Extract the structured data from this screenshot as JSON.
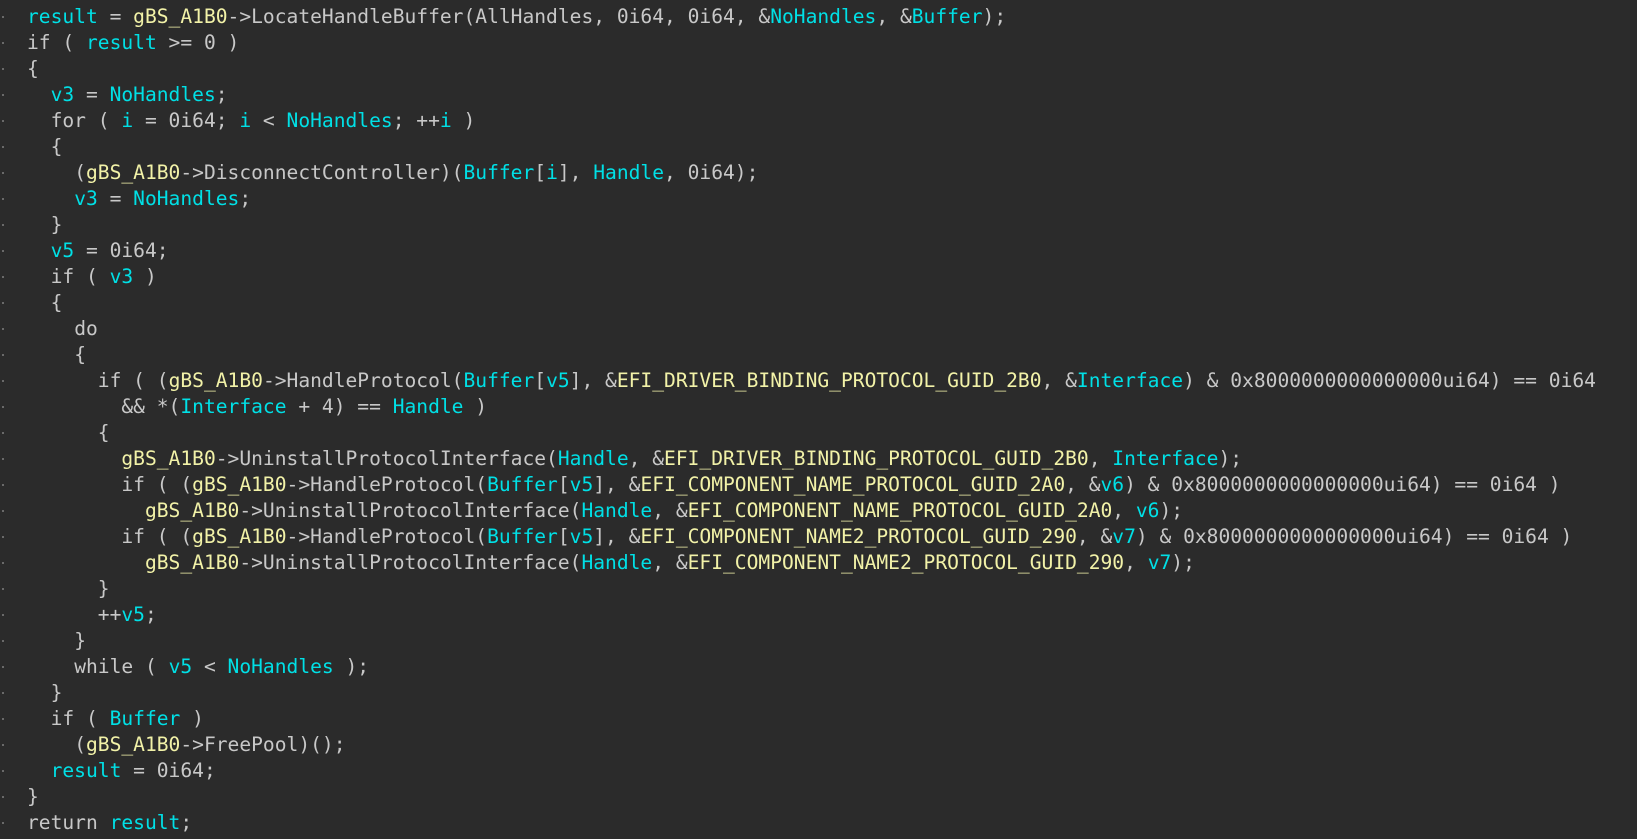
{
  "colors": {
    "background": "#2b2b2b",
    "default_text": "#c8c8c8",
    "variable": "#00e0e6",
    "global": "#f2f2a8"
  },
  "code_lines": [
    {
      "indent": 0,
      "tokens": [
        [
          "result",
          "variable"
        ],
        [
          " = ",
          "default"
        ],
        [
          "gBS_A1B0",
          "global"
        ],
        [
          "->LocateHandleBuffer(AllHandles, 0i64, 0i64, &",
          "default"
        ],
        [
          "NoHandles",
          "variable"
        ],
        [
          ", &",
          "default"
        ],
        [
          "Buffer",
          "variable"
        ],
        [
          ");",
          "default"
        ]
      ]
    },
    {
      "indent": 0,
      "tokens": [
        [
          "if ( ",
          "default"
        ],
        [
          "result",
          "variable"
        ],
        [
          " >= 0 )",
          "default"
        ]
      ]
    },
    {
      "indent": 0,
      "tokens": [
        [
          "{",
          "default"
        ]
      ]
    },
    {
      "indent": 1,
      "tokens": [
        [
          "v3",
          "variable"
        ],
        [
          " = ",
          "default"
        ],
        [
          "NoHandles",
          "variable"
        ],
        [
          ";",
          "default"
        ]
      ]
    },
    {
      "indent": 1,
      "tokens": [
        [
          "for ( ",
          "default"
        ],
        [
          "i",
          "variable"
        ],
        [
          " = 0i64; ",
          "default"
        ],
        [
          "i",
          "variable"
        ],
        [
          " < ",
          "default"
        ],
        [
          "NoHandles",
          "variable"
        ],
        [
          "; ++",
          "default"
        ],
        [
          "i",
          "variable"
        ],
        [
          " )",
          "default"
        ]
      ]
    },
    {
      "indent": 1,
      "tokens": [
        [
          "{",
          "default"
        ]
      ]
    },
    {
      "indent": 2,
      "tokens": [
        [
          "(",
          "default"
        ],
        [
          "gBS_A1B0",
          "global"
        ],
        [
          "->DisconnectController)(",
          "default"
        ],
        [
          "Buffer",
          "variable"
        ],
        [
          "[",
          "default"
        ],
        [
          "i",
          "variable"
        ],
        [
          "], ",
          "default"
        ],
        [
          "Handle",
          "variable"
        ],
        [
          ", 0i64);",
          "default"
        ]
      ]
    },
    {
      "indent": 2,
      "tokens": [
        [
          "v3",
          "variable"
        ],
        [
          " = ",
          "default"
        ],
        [
          "NoHandles",
          "variable"
        ],
        [
          ";",
          "default"
        ]
      ]
    },
    {
      "indent": 1,
      "tokens": [
        [
          "}",
          "default"
        ]
      ]
    },
    {
      "indent": 1,
      "tokens": [
        [
          "v5",
          "variable"
        ],
        [
          " = 0i64;",
          "default"
        ]
      ]
    },
    {
      "indent": 1,
      "tokens": [
        [
          "if ( ",
          "default"
        ],
        [
          "v3",
          "variable"
        ],
        [
          " )",
          "default"
        ]
      ]
    },
    {
      "indent": 1,
      "tokens": [
        [
          "{",
          "default"
        ]
      ]
    },
    {
      "indent": 2,
      "tokens": [
        [
          "do",
          "default"
        ]
      ]
    },
    {
      "indent": 2,
      "tokens": [
        [
          "{",
          "default"
        ]
      ]
    },
    {
      "indent": 3,
      "tokens": [
        [
          "if ( (",
          "default"
        ],
        [
          "gBS_A1B0",
          "global"
        ],
        [
          "->HandleProtocol(",
          "default"
        ],
        [
          "Buffer",
          "variable"
        ],
        [
          "[",
          "default"
        ],
        [
          "v5",
          "variable"
        ],
        [
          "], &",
          "default"
        ],
        [
          "EFI_DRIVER_BINDING_PROTOCOL_GUID_2B0",
          "global"
        ],
        [
          ", &",
          "default"
        ],
        [
          "Interface",
          "variable"
        ],
        [
          ") & 0x8000000000000000ui64) == 0i64",
          "default"
        ]
      ]
    },
    {
      "indent": 4,
      "tokens": [
        [
          "&& *(",
          "default"
        ],
        [
          "Interface",
          "variable"
        ],
        [
          " + 4) == ",
          "default"
        ],
        [
          "Handle",
          "variable"
        ],
        [
          " )",
          "default"
        ]
      ]
    },
    {
      "indent": 3,
      "tokens": [
        [
          "{",
          "default"
        ]
      ]
    },
    {
      "indent": 4,
      "tokens": [
        [
          "gBS_A1B0",
          "global"
        ],
        [
          "->UninstallProtocolInterface(",
          "default"
        ],
        [
          "Handle",
          "variable"
        ],
        [
          ", &",
          "default"
        ],
        [
          "EFI_DRIVER_BINDING_PROTOCOL_GUID_2B0",
          "global"
        ],
        [
          ", ",
          "default"
        ],
        [
          "Interface",
          "variable"
        ],
        [
          ");",
          "default"
        ]
      ]
    },
    {
      "indent": 4,
      "tokens": [
        [
          "if ( (",
          "default"
        ],
        [
          "gBS_A1B0",
          "global"
        ],
        [
          "->HandleProtocol(",
          "default"
        ],
        [
          "Buffer",
          "variable"
        ],
        [
          "[",
          "default"
        ],
        [
          "v5",
          "variable"
        ],
        [
          "], &",
          "default"
        ],
        [
          "EFI_COMPONENT_NAME_PROTOCOL_GUID_2A0",
          "global"
        ],
        [
          ", &",
          "default"
        ],
        [
          "v6",
          "variable"
        ],
        [
          ") & 0x8000000000000000ui64) == 0i64 )",
          "default"
        ]
      ]
    },
    {
      "indent": 5,
      "tokens": [
        [
          "gBS_A1B0",
          "global"
        ],
        [
          "->UninstallProtocolInterface(",
          "default"
        ],
        [
          "Handle",
          "variable"
        ],
        [
          ", &",
          "default"
        ],
        [
          "EFI_COMPONENT_NAME_PROTOCOL_GUID_2A0",
          "global"
        ],
        [
          ", ",
          "default"
        ],
        [
          "v6",
          "variable"
        ],
        [
          ");",
          "default"
        ]
      ]
    },
    {
      "indent": 4,
      "tokens": [
        [
          "if ( (",
          "default"
        ],
        [
          "gBS_A1B0",
          "global"
        ],
        [
          "->HandleProtocol(",
          "default"
        ],
        [
          "Buffer",
          "variable"
        ],
        [
          "[",
          "default"
        ],
        [
          "v5",
          "variable"
        ],
        [
          "], &",
          "default"
        ],
        [
          "EFI_COMPONENT_NAME2_PROTOCOL_GUID_290",
          "global"
        ],
        [
          ", &",
          "default"
        ],
        [
          "v7",
          "variable"
        ],
        [
          ") & 0x8000000000000000ui64) == 0i64 )",
          "default"
        ]
      ]
    },
    {
      "indent": 5,
      "tokens": [
        [
          "gBS_A1B0",
          "global"
        ],
        [
          "->UninstallProtocolInterface(",
          "default"
        ],
        [
          "Handle",
          "variable"
        ],
        [
          ", &",
          "default"
        ],
        [
          "EFI_COMPONENT_NAME2_PROTOCOL_GUID_290",
          "global"
        ],
        [
          ", ",
          "default"
        ],
        [
          "v7",
          "variable"
        ],
        [
          ");",
          "default"
        ]
      ]
    },
    {
      "indent": 3,
      "tokens": [
        [
          "}",
          "default"
        ]
      ]
    },
    {
      "indent": 3,
      "tokens": [
        [
          "++",
          "default"
        ],
        [
          "v5",
          "variable"
        ],
        [
          ";",
          "default"
        ]
      ]
    },
    {
      "indent": 2,
      "tokens": [
        [
          "}",
          "default"
        ]
      ]
    },
    {
      "indent": 2,
      "tokens": [
        [
          "while ( ",
          "default"
        ],
        [
          "v5",
          "variable"
        ],
        [
          " < ",
          "default"
        ],
        [
          "NoHandles",
          "variable"
        ],
        [
          " );",
          "default"
        ]
      ]
    },
    {
      "indent": 1,
      "tokens": [
        [
          "}",
          "default"
        ]
      ]
    },
    {
      "indent": 1,
      "tokens": [
        [
          "if ( ",
          "default"
        ],
        [
          "Buffer",
          "variable"
        ],
        [
          " )",
          "default"
        ]
      ]
    },
    {
      "indent": 2,
      "tokens": [
        [
          "(",
          "default"
        ],
        [
          "gBS_A1B0",
          "global"
        ],
        [
          "->FreePool)();",
          "default"
        ]
      ]
    },
    {
      "indent": 1,
      "tokens": [
        [
          "result",
          "variable"
        ],
        [
          " = 0i64;",
          "default"
        ]
      ]
    },
    {
      "indent": 0,
      "tokens": [
        [
          "}",
          "default"
        ]
      ]
    },
    {
      "indent": 0,
      "tokens": [
        [
          "return ",
          "default"
        ],
        [
          "result",
          "variable"
        ],
        [
          ";",
          "default"
        ]
      ]
    }
  ]
}
